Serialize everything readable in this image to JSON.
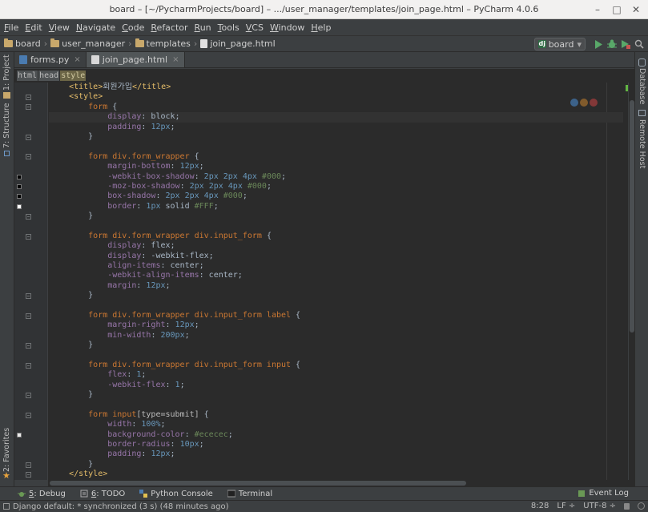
{
  "window": {
    "title": "board – [~/PycharmProjects/board] – .../user_manager/templates/join_page.html – PyCharm 4.0.6",
    "minimize": "–",
    "maximize": "□",
    "close": "✕"
  },
  "menu": {
    "items": [
      {
        "u": "F",
        "rest": "ile"
      },
      {
        "u": "E",
        "rest": "dit"
      },
      {
        "u": "V",
        "rest": "iew"
      },
      {
        "u": "N",
        "rest": "avigate"
      },
      {
        "u": "C",
        "rest": "ode"
      },
      {
        "u": "R",
        "rest": "efactor"
      },
      {
        "u": "R",
        "rest": "un"
      },
      {
        "u": "T",
        "rest": "ools"
      },
      {
        "u": "V",
        "rest": "CS"
      },
      {
        "u": "W",
        "rest": "indow"
      },
      {
        "u": "H",
        "rest": "elp"
      }
    ]
  },
  "navbar": {
    "crumbs": [
      "board",
      "user_manager",
      "templates",
      "join_page.html"
    ],
    "run_config": "board",
    "run_config_badge": "dj",
    "dropdown": "▾"
  },
  "tabs": [
    {
      "label": "forms.py",
      "active": false
    },
    {
      "label": "join_page.html",
      "active": true
    }
  ],
  "tab_close": "×",
  "tag_breadcrumbs": [
    "html",
    "head",
    "style"
  ],
  "left_tools": {
    "project": "1: Project",
    "structure": "7: Structure",
    "favorites": "2: Favorites"
  },
  "right_tools": {
    "database": "Database",
    "remote": "Remote Host"
  },
  "code_lines": [
    [
      [
        "t",
        "    <title>"
      ],
      [
        "v",
        "회원가입"
      ],
      [
        "t",
        "</title>"
      ]
    ],
    [
      [
        "t",
        "    <style>"
      ]
    ],
    [
      [
        "s",
        "        form "
      ],
      [
        "v",
        "{"
      ]
    ],
    [
      [
        "p",
        "            display"
      ],
      [
        "v",
        ": block;"
      ]
    ],
    [
      [
        "p",
        "            padding"
      ],
      [
        "v",
        ": "
      ],
      [
        "n",
        "12px"
      ],
      [
        "v",
        ";"
      ]
    ],
    [
      [
        "v",
        "        }"
      ]
    ],
    [
      [
        "v",
        ""
      ]
    ],
    [
      [
        "s",
        "        form div.form_wrapper "
      ],
      [
        "v",
        "{"
      ]
    ],
    [
      [
        "p",
        "            margin-bottom"
      ],
      [
        "v",
        ": "
      ],
      [
        "n",
        "12px"
      ],
      [
        "v",
        ";"
      ]
    ],
    [
      [
        "p",
        "            -webkit-box-shadow"
      ],
      [
        "v",
        ": "
      ],
      [
        "n",
        "2px 2px 4px "
      ],
      [
        "c",
        "#000"
      ],
      [
        "v",
        ";"
      ]
    ],
    [
      [
        "p",
        "            -moz-box-shadow"
      ],
      [
        "v",
        ": "
      ],
      [
        "n",
        "2px 2px 4px "
      ],
      [
        "c",
        "#000"
      ],
      [
        "v",
        ";"
      ]
    ],
    [
      [
        "p",
        "            box-shadow"
      ],
      [
        "v",
        ": "
      ],
      [
        "n",
        "2px 2px 4px "
      ],
      [
        "c",
        "#000"
      ],
      [
        "v",
        ";"
      ]
    ],
    [
      [
        "p",
        "            border"
      ],
      [
        "v",
        ": "
      ],
      [
        "n",
        "1px "
      ],
      [
        "v",
        "solid "
      ],
      [
        "c",
        "#FFF"
      ],
      [
        "v",
        ";"
      ]
    ],
    [
      [
        "v",
        "        }"
      ]
    ],
    [
      [
        "v",
        ""
      ]
    ],
    [
      [
        "s",
        "        form div.form_wrapper div.input_form "
      ],
      [
        "v",
        "{"
      ]
    ],
    [
      [
        "p",
        "            display"
      ],
      [
        "v",
        ": flex;"
      ]
    ],
    [
      [
        "p",
        "            display"
      ],
      [
        "v",
        ": -webkit-flex;"
      ]
    ],
    [
      [
        "p",
        "            align-items"
      ],
      [
        "v",
        ": center;"
      ]
    ],
    [
      [
        "p",
        "            -webkit-align-items"
      ],
      [
        "v",
        ": center;"
      ]
    ],
    [
      [
        "p",
        "            margin"
      ],
      [
        "v",
        ": "
      ],
      [
        "n",
        "12px"
      ],
      [
        "v",
        ";"
      ]
    ],
    [
      [
        "v",
        "        }"
      ]
    ],
    [
      [
        "v",
        ""
      ]
    ],
    [
      [
        "s",
        "        form div.form_wrapper div.input_form label "
      ],
      [
        "v",
        "{"
      ]
    ],
    [
      [
        "p",
        "            margin-right"
      ],
      [
        "v",
        ": "
      ],
      [
        "n",
        "12px"
      ],
      [
        "v",
        ";"
      ]
    ],
    [
      [
        "p",
        "            min-width"
      ],
      [
        "v",
        ": "
      ],
      [
        "n",
        "200px"
      ],
      [
        "v",
        ";"
      ]
    ],
    [
      [
        "v",
        "        }"
      ]
    ],
    [
      [
        "v",
        ""
      ]
    ],
    [
      [
        "s",
        "        form div.form_wrapper div.input_form input "
      ],
      [
        "v",
        "{"
      ]
    ],
    [
      [
        "p",
        "            flex"
      ],
      [
        "v",
        ": "
      ],
      [
        "n",
        "1"
      ],
      [
        "v",
        ";"
      ]
    ],
    [
      [
        "p",
        "            -webkit-flex"
      ],
      [
        "v",
        ": "
      ],
      [
        "n",
        "1"
      ],
      [
        "v",
        ";"
      ]
    ],
    [
      [
        "v",
        "        }"
      ]
    ],
    [
      [
        "v",
        ""
      ]
    ],
    [
      [
        "s",
        "        form input"
      ],
      [
        "a",
        "[type=submit]"
      ],
      [
        "v",
        " {"
      ]
    ],
    [
      [
        "p",
        "            width"
      ],
      [
        "v",
        ": "
      ],
      [
        "n",
        "100%"
      ],
      [
        "v",
        ";"
      ]
    ],
    [
      [
        "p",
        "            background-color"
      ],
      [
        "v",
        ": "
      ],
      [
        "c",
        "#ececec"
      ],
      [
        "v",
        ";"
      ]
    ],
    [
      [
        "p",
        "            border-radius"
      ],
      [
        "v",
        ": "
      ],
      [
        "n",
        "10px"
      ],
      [
        "v",
        ";"
      ]
    ],
    [
      [
        "p",
        "            padding"
      ],
      [
        "v",
        ": "
      ],
      [
        "n",
        "12px"
      ],
      [
        "v",
        ";"
      ]
    ],
    [
      [
        "v",
        "        }"
      ]
    ],
    [
      [
        "t",
        "    </style>"
      ]
    ]
  ],
  "current_line": 3,
  "swatches": [
    {
      "line": 9,
      "color": "#000000"
    },
    {
      "line": 10,
      "color": "#000000"
    },
    {
      "line": 11,
      "color": "#000000"
    },
    {
      "line": 12,
      "color": "#ffffff"
    },
    {
      "line": 35,
      "color": "#ececec"
    }
  ],
  "fold_lines": [
    1,
    2,
    5,
    7,
    13,
    15,
    21,
    23,
    26,
    28,
    31,
    33,
    38,
    39
  ],
  "tool_windows": [
    {
      "key": "5",
      "label": ": Debug",
      "icon": "debug-icon"
    },
    {
      "key": "6",
      "label": ": TODO",
      "icon": "todo-icon"
    },
    {
      "key": "",
      "label": "Python Console",
      "icon": "python-console-icon"
    },
    {
      "key": "",
      "label": "Terminal",
      "icon": "terminal-icon"
    }
  ],
  "event_log": "Event Log",
  "status": {
    "message": "Django default: * synchronized (3 s) (48 minutes ago)",
    "position": "8:28",
    "line_sep": "LF ÷",
    "encoding": "UTF-8 ÷"
  },
  "colors": {
    "tag": "#e8bf6a",
    "selector": "#cc7832",
    "property": "#9876aa",
    "number": "#6897bb",
    "hex_color": "#6a8759",
    "editor_bg": "#2b2b2b",
    "ok_mark": "#62b543"
  }
}
